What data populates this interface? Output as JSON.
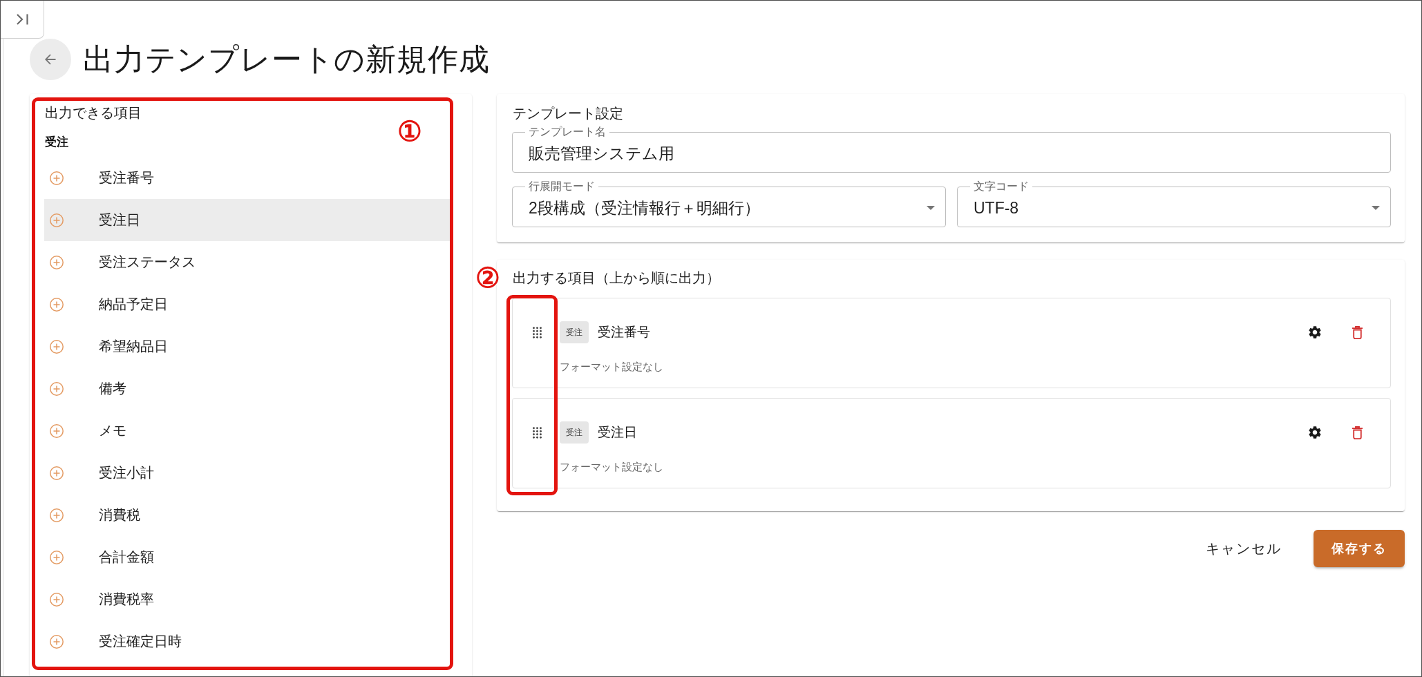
{
  "page": {
    "title": "出力テンプレートの新規作成"
  },
  "available_fields": {
    "title": "出力できる項目",
    "annotation_marker": "①",
    "group": "受注",
    "items": [
      {
        "label": "受注番号",
        "highlighted": false
      },
      {
        "label": "受注日",
        "highlighted": true
      },
      {
        "label": "受注ステータス",
        "highlighted": false
      },
      {
        "label": "納品予定日",
        "highlighted": false
      },
      {
        "label": "希望納品日",
        "highlighted": false
      },
      {
        "label": "備考",
        "highlighted": false
      },
      {
        "label": "メモ",
        "highlighted": false
      },
      {
        "label": "受注小計",
        "highlighted": false
      },
      {
        "label": "消費税",
        "highlighted": false
      },
      {
        "label": "合計金額",
        "highlighted": false
      },
      {
        "label": "消費税率",
        "highlighted": false
      },
      {
        "label": "受注確定日時",
        "highlighted": false
      }
    ]
  },
  "template_settings": {
    "title": "テンプレート設定",
    "name_field": {
      "label": "テンプレート名",
      "value": "販売管理システム用"
    },
    "selects": [
      {
        "label": "行展開モード",
        "value": "2段構成（受注情報行＋明細行）"
      },
      {
        "label": "文字コード",
        "value": "UTF-8"
      }
    ]
  },
  "output_fields": {
    "title": "出力する項目（上から順に出力）",
    "annotation_marker": "②",
    "items": [
      {
        "tag": "受注",
        "name": "受注番号",
        "format": "フォーマット設定なし"
      },
      {
        "tag": "受注",
        "name": "受注日",
        "format": "フォーマット設定なし"
      }
    ]
  },
  "actions": [
    {
      "label": "キャンセル",
      "kind": "text"
    },
    {
      "label": "保存する",
      "kind": "primary"
    }
  ]
}
